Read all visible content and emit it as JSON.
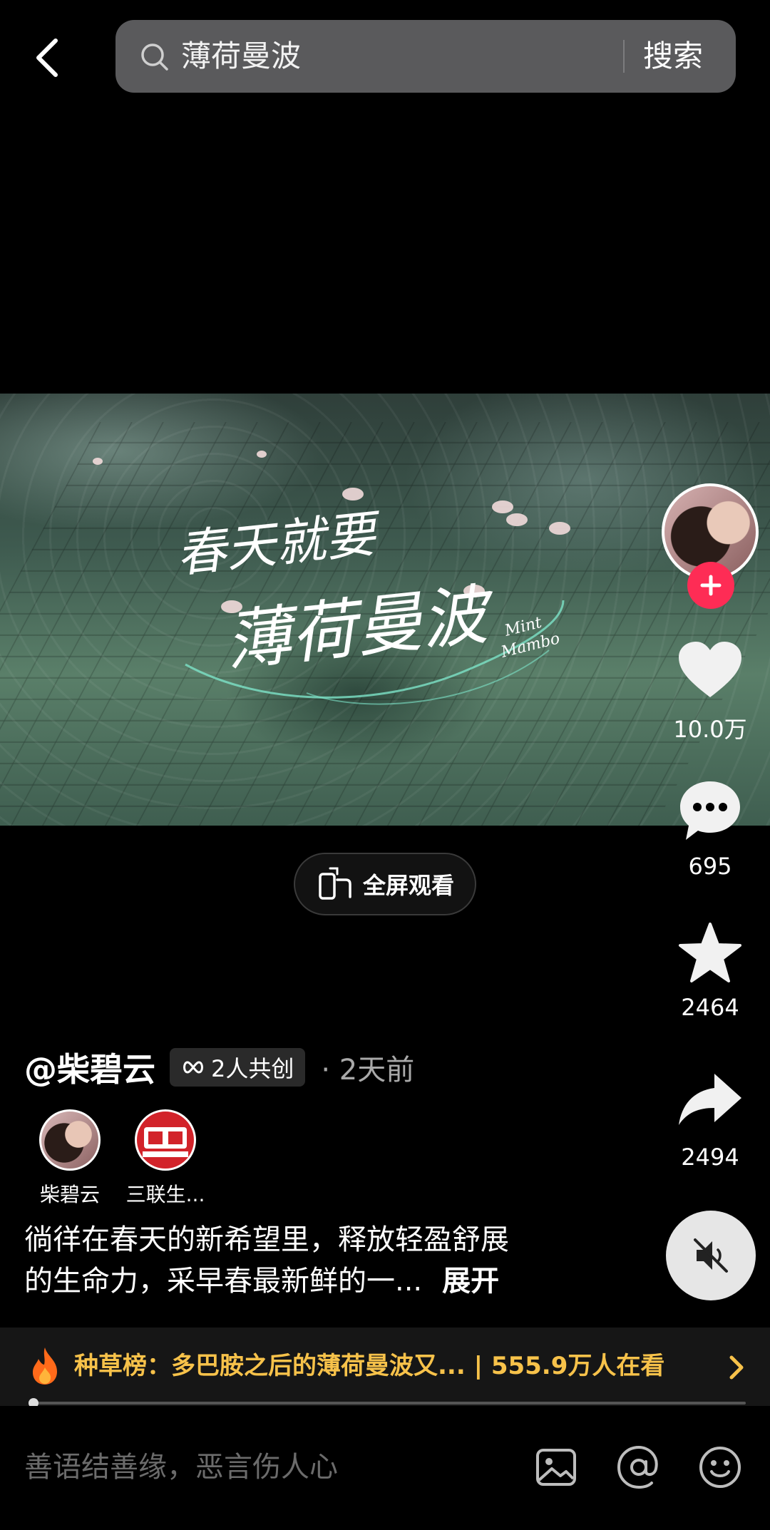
{
  "header": {
    "back_icon": "chevron-left-icon",
    "search": {
      "query": "薄荷曼波",
      "icon": "search-icon",
      "button_label": "搜索"
    }
  },
  "video": {
    "title_art_text": "春天就要 薄荷曼波 Mint Mambo"
  },
  "actions": {
    "likes": "10.0万",
    "comments": "695",
    "favorites": "2464",
    "shares": "2494",
    "like_icon": "heart-icon",
    "comment_icon": "comment-bubble-icon",
    "favorite_icon": "star-icon",
    "share_icon": "share-arrow-icon",
    "follow_icon": "plus-icon",
    "mute_icon": "speaker-muted-icon"
  },
  "fullscreen": {
    "label": "全屏观看",
    "icon": "rotate-phone-icon"
  },
  "post": {
    "author": "@柴碧云",
    "collab_tag": "2人共创",
    "collab_icon": "infinity-link-icon",
    "time": "· 2天前",
    "creators": [
      {
        "name": "柴碧云"
      },
      {
        "name": "三联生..."
      }
    ],
    "description_line1": "徜徉在春天的新希望里，释放轻盈舒展",
    "description_line2": "的生命力，采早春最新鲜的一...",
    "expand_label": "展开"
  },
  "trending": {
    "icon": "flame-icon",
    "text": "种草榜：多巴胺之后的薄荷曼波又... | 555.9万人在看",
    "arrow_icon": "chevron-right-icon"
  },
  "playback": {
    "progress": 0.005
  },
  "comment_bar": {
    "placeholder": "善语结善缘，恶言伤人心",
    "icons": [
      "image-icon",
      "at-sign-icon",
      "emoji-icon"
    ]
  },
  "colors": {
    "accent_red": "#fe2c55",
    "trend_gold": "#f7c24a"
  }
}
